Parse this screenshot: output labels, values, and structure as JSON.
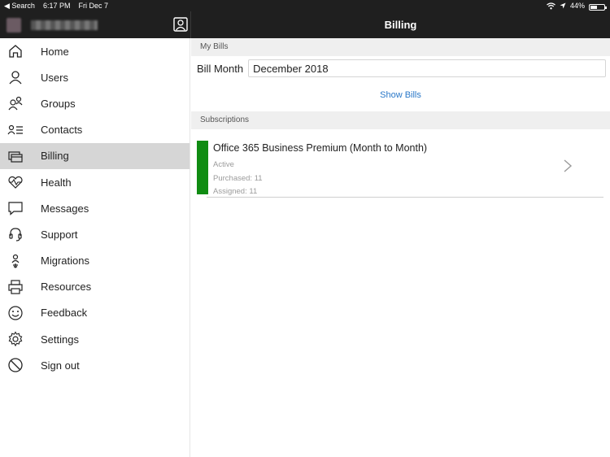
{
  "status_bar": {
    "back_label": "◀ Search",
    "time": "6:17 PM",
    "date": "Fri Dec 7",
    "battery": "44%"
  },
  "nav": {
    "title": "Billing"
  },
  "sidebar": {
    "items": [
      {
        "label": "Home",
        "icon": "home-icon"
      },
      {
        "label": "Users",
        "icon": "user-icon"
      },
      {
        "label": "Groups",
        "icon": "groups-icon"
      },
      {
        "label": "Contacts",
        "icon": "contacts-icon"
      },
      {
        "label": "Billing",
        "icon": "billing-icon",
        "active": true
      },
      {
        "label": "Health",
        "icon": "health-icon"
      },
      {
        "label": "Messages",
        "icon": "message-icon"
      },
      {
        "label": "Support",
        "icon": "headset-icon"
      },
      {
        "label": "Migrations",
        "icon": "migration-icon"
      },
      {
        "label": "Resources",
        "icon": "resources-icon"
      },
      {
        "label": "Feedback",
        "icon": "smiley-icon"
      },
      {
        "label": "Settings",
        "icon": "gear-icon"
      },
      {
        "label": "Sign out",
        "icon": "sign-out-icon"
      }
    ]
  },
  "main": {
    "my_bills_header": "My Bills",
    "bill_month_label": "Bill Month",
    "bill_month_value": "December 2018",
    "show_bills_label": "Show Bills",
    "subscriptions_header": "Subscriptions",
    "subscription": {
      "title": "Office 365 Business Premium (Month to Month)",
      "status": "Active",
      "purchased": "Purchased: 11",
      "assigned": "Assigned: 11",
      "status_color": "#108c12"
    }
  },
  "colors": {
    "bar": "#1f1f1f",
    "link": "#2a78c8",
    "active_row": "#d6d6d6"
  }
}
